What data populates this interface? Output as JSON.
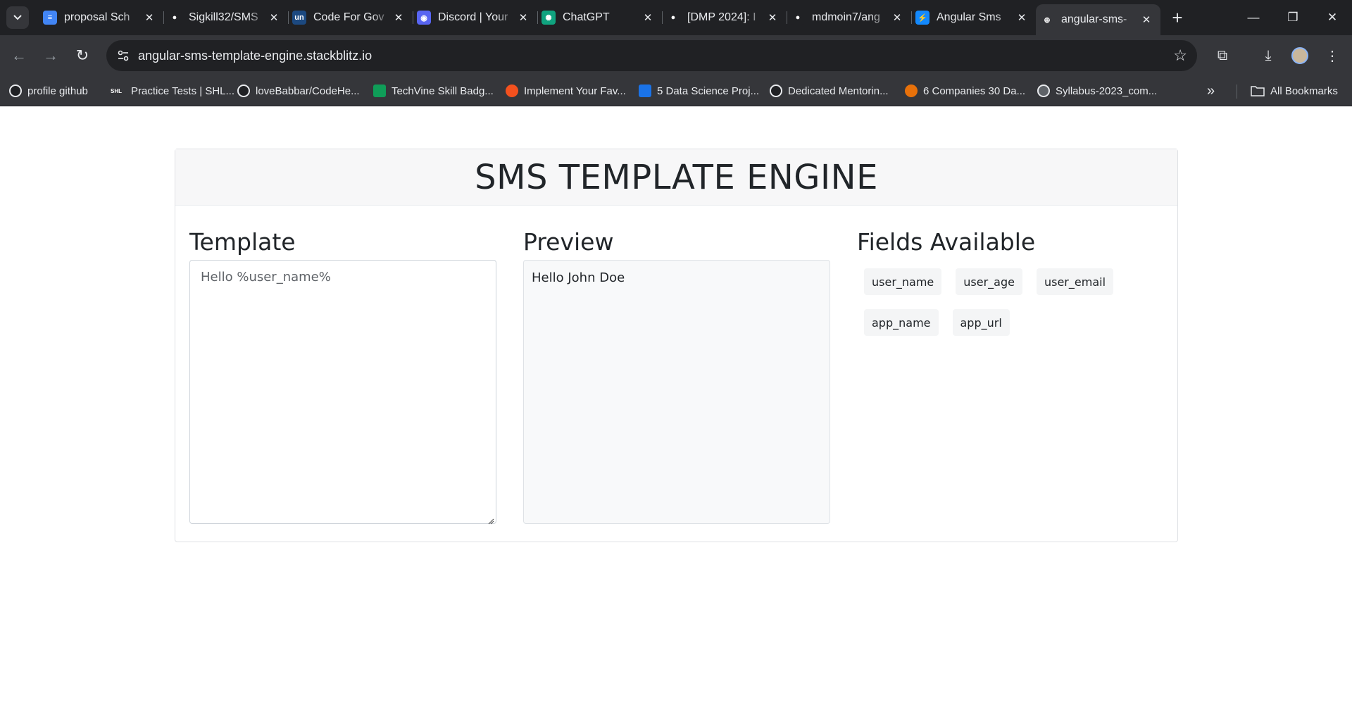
{
  "browser": {
    "tabs": [
      {
        "title": "proposal Sch",
        "icon": "docs-icon",
        "color": "#4285f4",
        "glyph": "≡"
      },
      {
        "title": "Sigkill32/SMS",
        "icon": "github-icon",
        "color": "#202124",
        "glyph": "●"
      },
      {
        "title": "Code For Gov",
        "icon": "unstop-icon",
        "color": "#1c4980",
        "glyph": "un"
      },
      {
        "title": "Discord | Your",
        "icon": "discord-icon",
        "color": "#5865f2",
        "glyph": "◉"
      },
      {
        "title": "ChatGPT",
        "icon": "chatgpt-icon",
        "color": "#10a37f",
        "glyph": "✺"
      },
      {
        "title": "[DMP 2024]: I",
        "icon": "github-icon",
        "color": "#202124",
        "glyph": "●"
      },
      {
        "title": "mdmoin7/ang",
        "icon": "github-icon",
        "color": "#202124",
        "glyph": "●"
      },
      {
        "title": "Angular Sms",
        "icon": "stackblitz-icon",
        "color": "#1389fd",
        "glyph": "⚡"
      },
      {
        "title": "angular-sms-",
        "icon": "globe-icon",
        "color": "#35363a",
        "glyph": "⊕"
      }
    ],
    "active_tab_index": 8,
    "url": "angular-sms-template-engine.stackblitz.io",
    "bookmarks": [
      {
        "label": "profile github",
        "icon": "github-icon"
      },
      {
        "label": "Practice Tests | SHL...",
        "icon": "shl-icon"
      },
      {
        "label": "loveBabbar/CodeHe...",
        "icon": "github-icon"
      },
      {
        "label": "TechVine Skill Badg...",
        "icon": "sheets-icon"
      },
      {
        "label": "Implement Your Fav...",
        "icon": "orange-blocks-icon"
      },
      {
        "label": "5 Data Science Proj...",
        "icon": "pp-icon"
      },
      {
        "label": "Dedicated Mentorin...",
        "icon": "github-icon"
      },
      {
        "label": "6 Companies 30 Da...",
        "icon": "leaf-icon"
      },
      {
        "label": "Syllabus-2023_com...",
        "icon": "globe-icon"
      }
    ],
    "all_bookmarks_label": "All Bookmarks"
  },
  "app": {
    "title": "SMS TEMPLATE ENGINE",
    "template": {
      "heading": "Template",
      "value": "Hello %user_name%"
    },
    "preview": {
      "heading": "Preview",
      "text": "Hello John Doe"
    },
    "fields": {
      "heading": "Fields Available",
      "items": [
        "user_name",
        "user_age",
        "user_email",
        "app_name",
        "app_url"
      ]
    }
  }
}
